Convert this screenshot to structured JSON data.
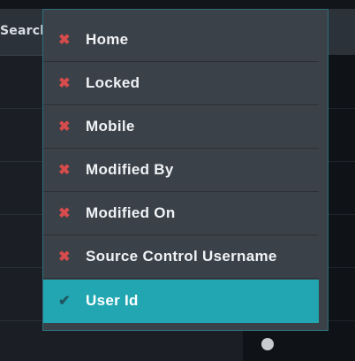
{
  "search": {
    "label": "Search"
  },
  "menu": {
    "items": [
      {
        "label": "Home",
        "icon": "close-icon",
        "state": "unchecked"
      },
      {
        "label": "Locked",
        "icon": "close-icon",
        "state": "unchecked"
      },
      {
        "label": "Mobile",
        "icon": "close-icon",
        "state": "unchecked"
      },
      {
        "label": "Modified By",
        "icon": "close-icon",
        "state": "unchecked"
      },
      {
        "label": "Modified On",
        "icon": "close-icon",
        "state": "unchecked"
      },
      {
        "label": "Source Control Username",
        "icon": "close-icon",
        "state": "unchecked"
      },
      {
        "label": "User Id",
        "icon": "check-icon",
        "state": "checked"
      }
    ]
  },
  "colors": {
    "accent": "#22a7b2",
    "unchecked_icon": "#d64b4b",
    "menu_bg": "#3b4148"
  }
}
